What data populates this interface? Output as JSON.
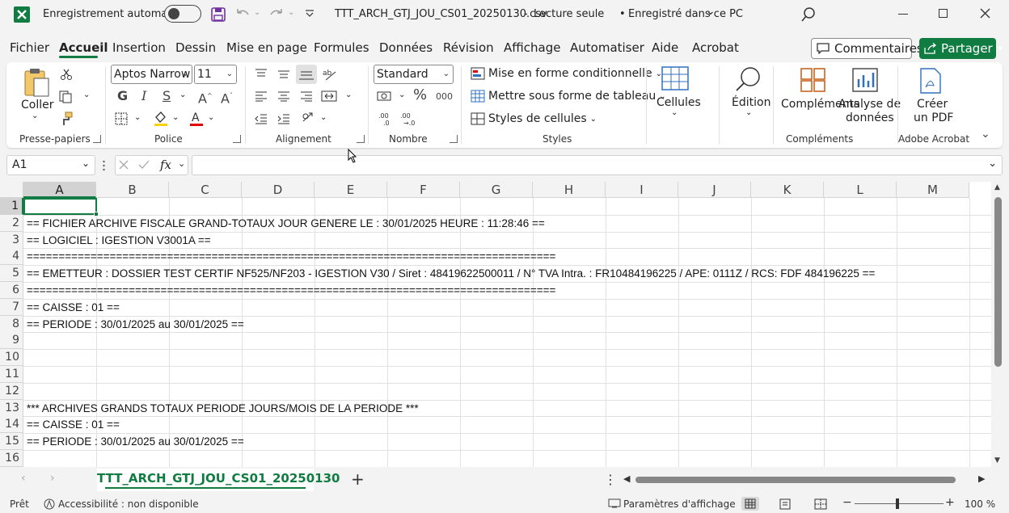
{
  "titlebar": {
    "autosave_label": "Enregistrement automatique",
    "filename": "TTT_ARCH_GTJ_JOU_CS01_20250130.csv",
    "separator": "-",
    "mode": "Lecture seule",
    "bullet": "•",
    "saved_state": "Enregistré dans ce PC"
  },
  "menu": {
    "tabs": [
      "Fichier",
      "Accueil",
      "Insertion",
      "Dessin",
      "Mise en page",
      "Formules",
      "Données",
      "Révision",
      "Affichage",
      "Automatiser",
      "Aide",
      "Acrobat"
    ],
    "comments_label": "Commentaires",
    "share_label": "Partager"
  },
  "ribbon": {
    "paste_label": "Coller",
    "font_name": "Aptos Narrow",
    "font_size": "11",
    "number_format": "Standard",
    "conditional_format": "Mise en forme conditionnelle",
    "format_as_table": "Mettre sous forme de tableau",
    "cell_styles": "Styles de cellules",
    "cells_label": "Cellules",
    "editing_label": "Édition",
    "addins_label": "Compléments",
    "data_analysis_line1": "Analyse de",
    "data_analysis_line2": "données",
    "create_pdf_line1": "Créer",
    "create_pdf_line2": "un PDF",
    "groups": {
      "clipboard": "Presse-papiers",
      "font": "Police",
      "alignment": "Alignement",
      "number": "Nombre",
      "styles": "Styles",
      "addins": "Compléments",
      "acrobat": "Adobe Acrobat"
    },
    "font_colors": {
      "highlight": "#ffd000",
      "text": "#e00000"
    }
  },
  "formula_bar": {
    "name_box": "A1",
    "fx": "fx",
    "value": ""
  },
  "grid": {
    "columns": [
      "A",
      "B",
      "C",
      "D",
      "E",
      "F",
      "G",
      "H",
      "I",
      "J",
      "K",
      "L",
      "M"
    ],
    "rows": [
      "1",
      "2",
      "3",
      "4",
      "5",
      "6",
      "7",
      "8",
      "9",
      "10",
      "11",
      "12",
      "13",
      "14",
      "15",
      "16"
    ],
    "cells": {
      "r1": "",
      "r2": "== FICHIER ARCHIVE FISCALE GRAND-TOTAUX JOUR GENERE LE : 30/01/2025 HEURE : 11:28:46 ==",
      "r3": "== LOGICIEL : IGESTION V3001A ==",
      "r4": "===================================================================================",
      "r5": "== EMETTEUR : DOSSIER TEST CERTIF NF525/NF203 - IGESTION V30 / Siret : 48419622500011 / N° TVA Intra. : FR10484196225 / APE: 0111Z / RCS: FDF 484196225 ==",
      "r6": "===================================================================================",
      "r7": "== CAISSE : 01 ==",
      "r8": "== PERIODE : 30/01/2025 au 30/01/2025 ==",
      "r9": "",
      "r10": "",
      "r11": "",
      "r12": "",
      "r13": "*** ARCHIVES GRANDS TOTAUX PERIODE JOURS/MOIS DE LA PERIODE ***",
      "r14": "== CAISSE : 01 ==",
      "r15": "== PERIODE : 30/01/2025 au 30/01/2025 ==",
      "r16": ""
    }
  },
  "sheet_tabs": {
    "active": "TTT_ARCH_GTJ_JOU_CS01_20250130",
    "add": "+"
  },
  "status": {
    "ready": "Prêt",
    "accessibility": "Accessibilité : non disponible",
    "display_settings": "Paramètres d'affichage",
    "zoom_minus": "−",
    "zoom_plus": "+",
    "zoom": "100 %"
  },
  "colors": {
    "accent": "#107c41",
    "excel_icon": "#107c41"
  }
}
